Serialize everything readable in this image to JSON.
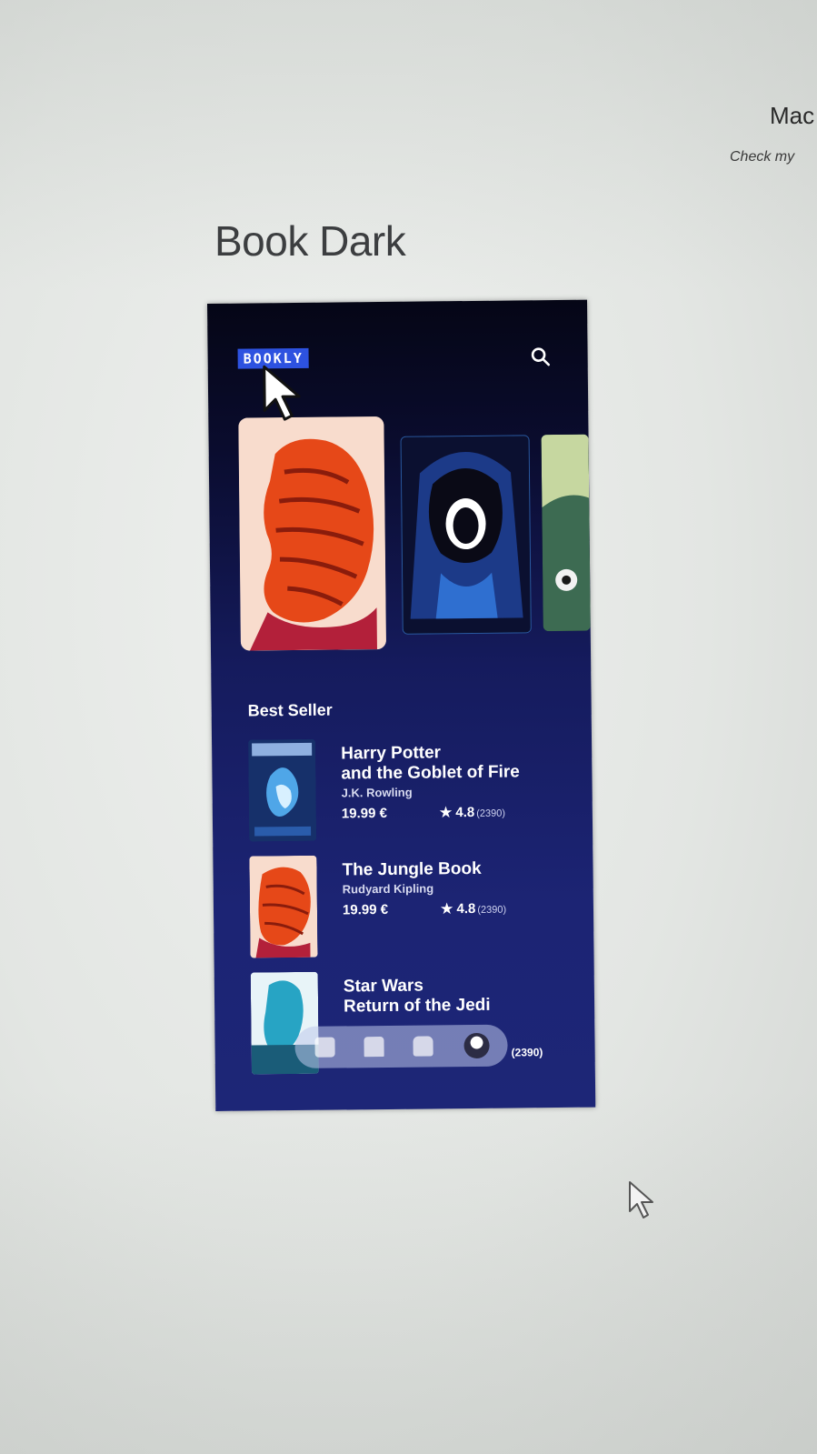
{
  "corner": {
    "name": "Mac",
    "subtitle": "Check my"
  },
  "page_title": "Book Dark",
  "app": {
    "logo": "BOOKLY",
    "section_title": "Best Seller",
    "colors": {
      "accent": "#2d52e0",
      "background_top": "#050616",
      "background_bottom": "#1d2677"
    },
    "books": [
      {
        "title": "Harry Potter\nand the Goblet of Fire",
        "author": "J.K. Rowling",
        "price": "19.99 €",
        "rating": "4.8",
        "count": "(2390)"
      },
      {
        "title": "The Jungle Book",
        "author": "Rudyard Kipling",
        "price": "19.99 €",
        "rating": "4.8",
        "count": "(2390)"
      },
      {
        "title": "Star Wars\nReturn of the Jedi",
        "count": "(2390)"
      }
    ],
    "nav_icons": [
      "home-icon",
      "bookmark-icon",
      "bag-icon",
      "profile-avatar"
    ]
  }
}
